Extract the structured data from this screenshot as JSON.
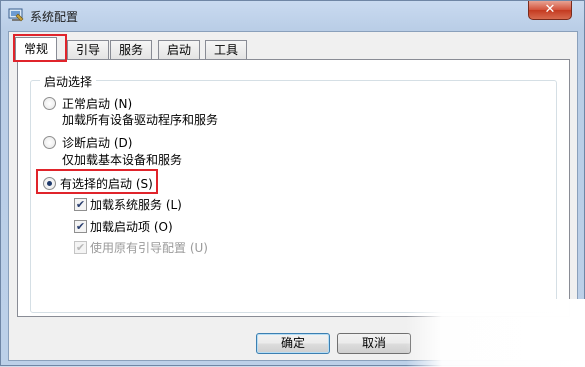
{
  "window": {
    "title": "系统配置",
    "close_label": "✕"
  },
  "tabs": [
    {
      "label": "常规",
      "active": true
    },
    {
      "label": "引导",
      "active": false
    },
    {
      "label": "服务",
      "active": false
    },
    {
      "label": "启动",
      "active": false
    },
    {
      "label": "工具",
      "active": false
    }
  ],
  "startup": {
    "group_label": "启动选择",
    "normal": {
      "label": "正常启动 (N)",
      "desc": "加载所有设备驱动程序和服务",
      "selected": false
    },
    "diagnostic": {
      "label": "诊断启动 (D)",
      "desc": "仅加载基本设备和服务",
      "selected": false
    },
    "selective": {
      "label": "有选择的启动 (S)",
      "selected": true
    },
    "options": [
      {
        "label": "加载系统服务 (L)",
        "checked": true,
        "enabled": true
      },
      {
        "label": "加载启动项 (O)",
        "checked": true,
        "enabled": true
      },
      {
        "label": "使用原有引导配置 (U)",
        "checked": true,
        "enabled": false
      }
    ]
  },
  "buttons": {
    "ok": "确定",
    "cancel": "取消"
  },
  "colors": {
    "highlight": "#e0242b",
    "title_bar": "#c9daf0",
    "close_button": "#c43a20"
  }
}
